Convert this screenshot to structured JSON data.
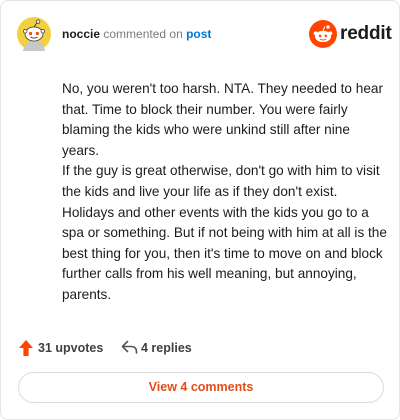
{
  "header": {
    "username": "noccie",
    "action_text": "commented on",
    "target_text": "post",
    "brand_word": "reddit"
  },
  "comment": {
    "paragraphs": [
      "No, you weren't too harsh. NTA. They needed to hear that. Time to block their number. You were fairly blaming the kids who were unkind still after nine years.",
      "If the guy is great otherwise, don't go with him to visit the kids and live your life as if they don't exist. Holidays and other events with the kids you go to a spa or something. But if not being with him at all is the best thing for you, then it's time to move on and block further calls from his well meaning, but annoying, parents."
    ]
  },
  "actions": {
    "upvotes_label": "31 upvotes",
    "replies_label": "4 replies"
  },
  "footer": {
    "view_label": "View 4 comments"
  },
  "icons": {
    "avatar": "snoo-avatar-icon",
    "brand": "reddit-logo-icon",
    "upvote": "upvote-arrow-icon",
    "reply": "reply-arrow-icon"
  },
  "colors": {
    "accent": "#ff4500",
    "link": "#0079d3",
    "avatar_bg": "#f4d03f",
    "text": "#1c1c1c",
    "muted": "#7c7c7c"
  }
}
